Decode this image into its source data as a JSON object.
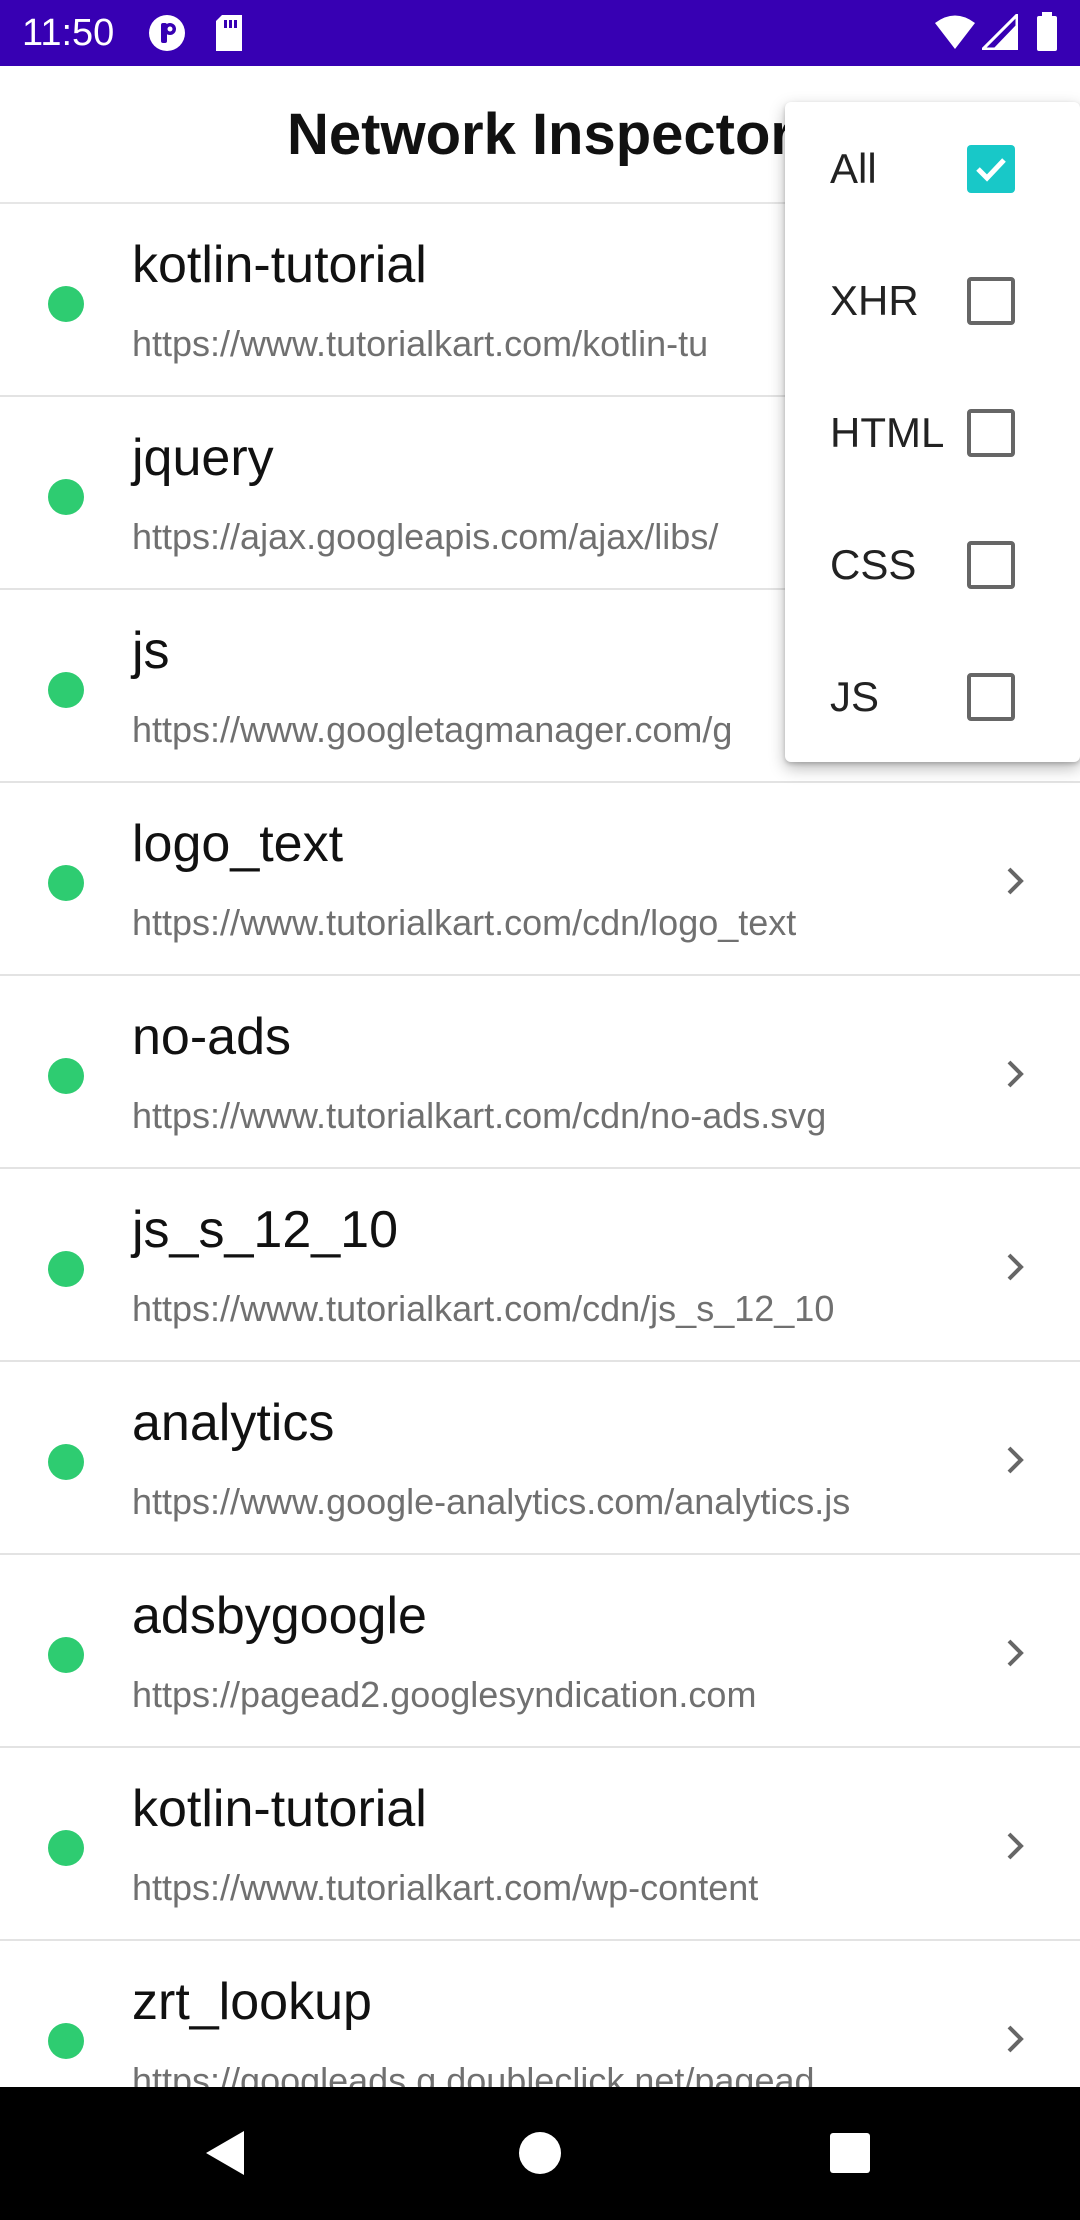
{
  "status_bar": {
    "time": "11:50",
    "left_icons": [
      "p-badge-icon",
      "sd-card-icon"
    ],
    "right_icons": [
      "wifi-icon",
      "cellular-signal-icon",
      "battery-icon"
    ],
    "background_color": "#3700b3"
  },
  "app_bar": {
    "title": "Network Inspector"
  },
  "requests": [
    {
      "title": "kotlin-tutorial",
      "url": "https://www.tutorialkart.com/kotlin-tu",
      "status_color": "#2ecc71"
    },
    {
      "title": "jquery",
      "url": "https://ajax.googleapis.com/ajax/libs/",
      "status_color": "#2ecc71"
    },
    {
      "title": "js",
      "url": "https://www.googletagmanager.com/g",
      "status_color": "#2ecc71"
    },
    {
      "title": "logo_text",
      "url": "https://www.tutorialkart.com/cdn/logo_text",
      "status_color": "#2ecc71"
    },
    {
      "title": "no-ads",
      "url": "https://www.tutorialkart.com/cdn/no-ads.svg",
      "status_color": "#2ecc71"
    },
    {
      "title": "js_s_12_10",
      "url": "https://www.tutorialkart.com/cdn/js_s_12_10",
      "status_color": "#2ecc71"
    },
    {
      "title": "analytics",
      "url": "https://www.google-analytics.com/analytics.js",
      "status_color": "#2ecc71"
    },
    {
      "title": "adsbygoogle",
      "url": "https://pagead2.googlesyndication.com",
      "status_color": "#2ecc71"
    },
    {
      "title": "kotlin-tutorial",
      "url": "https://www.tutorialkart.com/wp-content",
      "status_color": "#2ecc71"
    },
    {
      "title": "zrt_lookup",
      "url": "https://googleads.g.doubleclick.net/pagead",
      "status_color": "#2ecc71"
    }
  ],
  "filter_menu": {
    "items": [
      {
        "label": "All",
        "checked": true
      },
      {
        "label": "XHR",
        "checked": false
      },
      {
        "label": "HTML",
        "checked": false
      },
      {
        "label": "CSS",
        "checked": false
      },
      {
        "label": "JS",
        "checked": false
      }
    ],
    "checked_color": "#18c8c8"
  },
  "nav_bar": {
    "buttons": [
      "back-icon",
      "home-icon",
      "recents-icon"
    ]
  }
}
